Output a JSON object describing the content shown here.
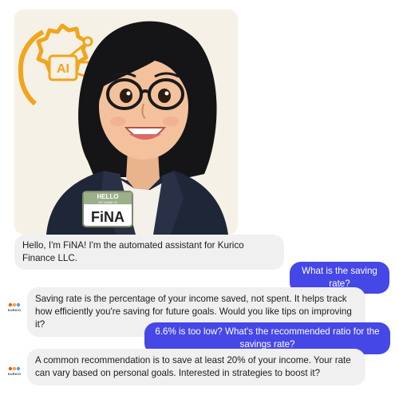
{
  "assistant": {
    "badge_hello": "HELLO",
    "badge_sub": "MY NAME IS",
    "badge_name": "FiNA",
    "ai_label": "AI",
    "logo_text": "KURICO",
    "colors": {
      "brand_blue": "#4547e6",
      "bot_bubble": "#f0f0f0",
      "ai_orange": "#f1a51d"
    }
  },
  "messages": [
    {
      "sender": "bot",
      "text": "Hello, I'm FiNA! I'm the automated assistant for Kurico Finance LLC."
    },
    {
      "sender": "user",
      "text": "What is the saving rate?"
    },
    {
      "sender": "bot",
      "text": "Saving rate is the percentage of your income saved, not spent. It helps track how efficiently you're saving for future goals. Would you like tips on improving it?"
    },
    {
      "sender": "user",
      "text": "6.6% is too low? What's the recommended ratio for the savings rate?"
    },
    {
      "sender": "bot",
      "text": "A common recommendation is to save at least 20% of your income. Your rate can vary based on personal goals. Interested in strategies to boost it?"
    }
  ]
}
